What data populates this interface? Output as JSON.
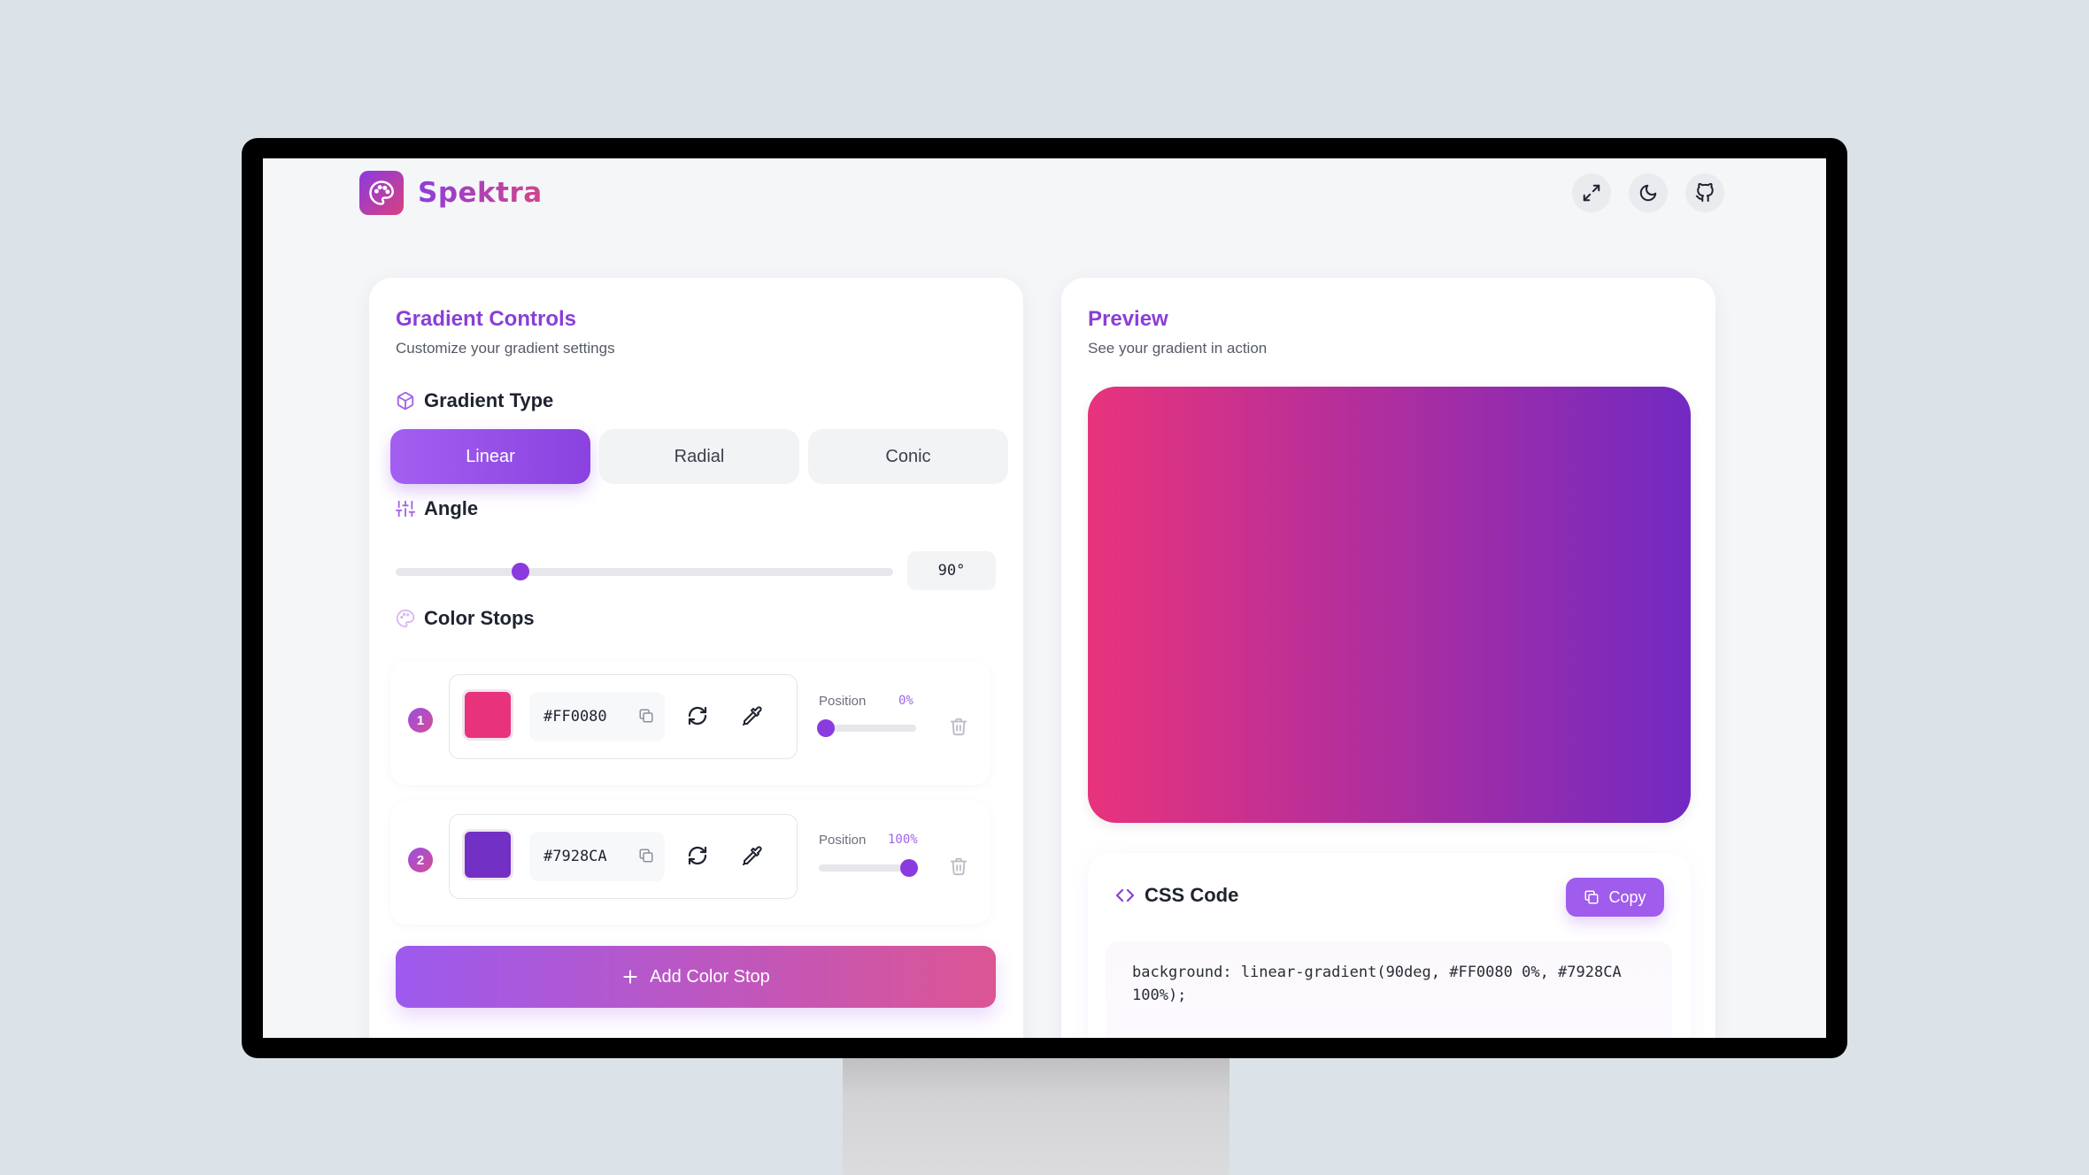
{
  "app": {
    "name": "Spektra",
    "header_actions": [
      {
        "icon": "fullscreen-icon",
        "label": "Fullscreen"
      },
      {
        "icon": "moon-icon",
        "label": "Dark mode"
      },
      {
        "icon": "github-icon",
        "label": "GitHub"
      }
    ]
  },
  "controls": {
    "title": "Gradient Controls",
    "subtitle": "Customize your gradient settings",
    "gradient_type": {
      "label": "Gradient Type",
      "options": [
        "Linear",
        "Radial",
        "Conic"
      ],
      "selected": "Linear"
    },
    "angle": {
      "label": "Angle",
      "value": 90,
      "display": "90°",
      "min": 0,
      "max": 360
    },
    "color_stops": {
      "label": "Color Stops",
      "position_label": "Position",
      "items": [
        {
          "index": "1",
          "color": "#FF0080",
          "swatch": "#e8337c",
          "position": 0,
          "position_display": "0%"
        },
        {
          "index": "2",
          "color": "#7928CA",
          "swatch": "#7330c4",
          "position": 100,
          "position_display": "100%"
        }
      ]
    },
    "add_button": "Add Color Stop"
  },
  "preview": {
    "title": "Preview",
    "subtitle": "See your gradient in action",
    "gradient": {
      "angle": 90,
      "from": "#e8337c",
      "to": "#7229c2"
    }
  },
  "css_code": {
    "title": "CSS Code",
    "copy_label": "Copy",
    "code": "background: linear-gradient(90deg, #FF0080 0%, #7928CA 100%);"
  },
  "colors": {
    "accent": "#8a3be0",
    "accent_pink": "#d9407e"
  }
}
